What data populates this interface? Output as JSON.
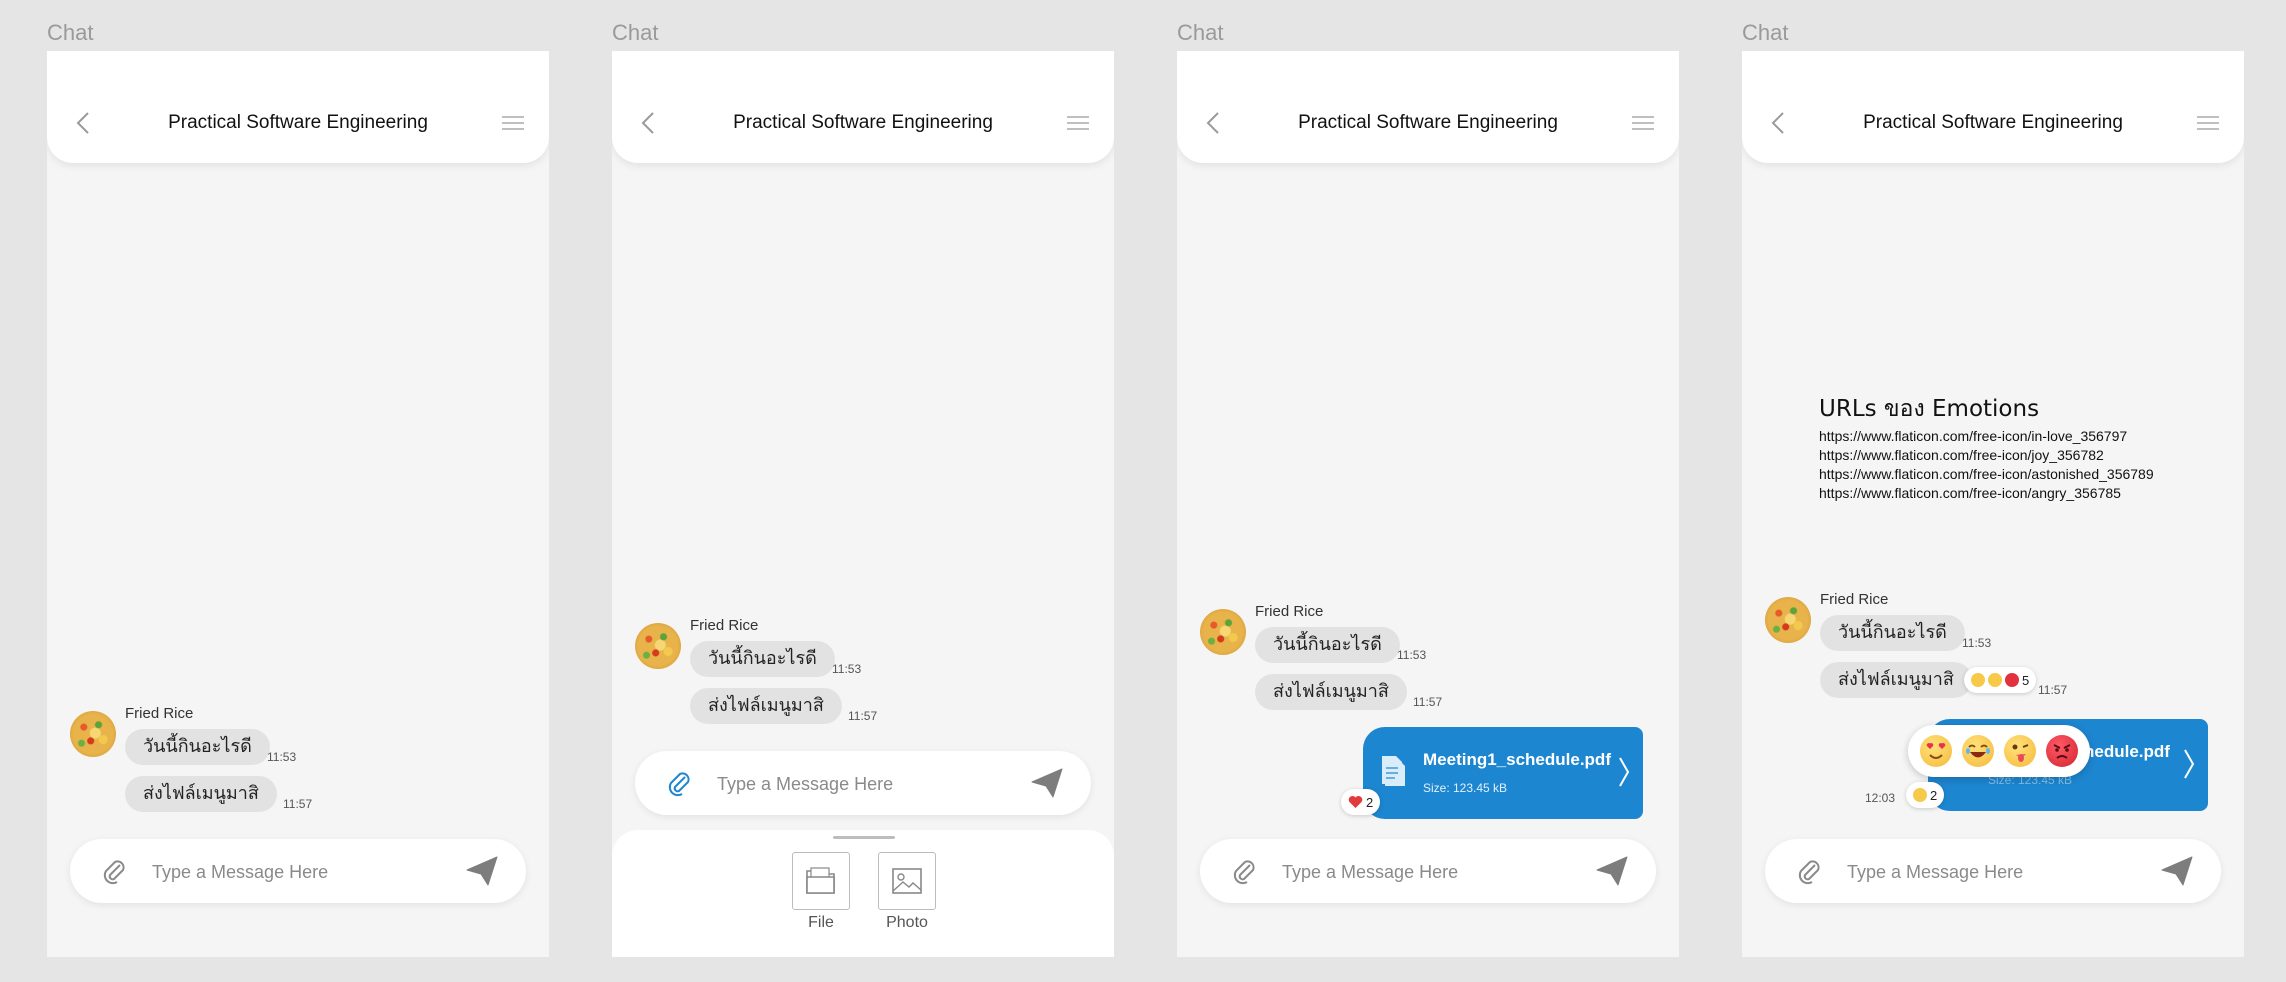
{
  "frames": [
    {
      "label": "Chat"
    },
    {
      "label": "Chat"
    },
    {
      "label": "Chat"
    },
    {
      "label": "Chat"
    }
  ],
  "header": {
    "title": "Practical Software Engineering"
  },
  "sender": {
    "name": "Fried Rice"
  },
  "messages": [
    {
      "text": "วันนี้กินอะไรดี",
      "time": "11:53"
    },
    {
      "text": "ส่งไฟล์เมนูมาสิ",
      "time": "11:57"
    }
  ],
  "input": {
    "placeholder": "Type a Message Here"
  },
  "attach_sheet": {
    "file_label": "File",
    "photo_label": "Photo"
  },
  "file_message": {
    "name": "Meeting1_schedule.pdf",
    "name_partial": "hedule.pdf",
    "size": "Size: 123.45 kB",
    "time": "12:03"
  },
  "reactions": {
    "frame3_count": "2",
    "frame4_text_count": "5",
    "frame4_file_count": "2"
  },
  "emotions": {
    "heading": "URLs ของ Emotions",
    "urls": [
      "https://www.flaticon.com/free-icon/in-love_356797",
      "https://www.flaticon.com/free-icon/joy_356782",
      "https://www.flaticon.com/free-icon/astonished_356789",
      "https://www.flaticon.com/free-icon/angry_356785"
    ]
  },
  "colors": {
    "accent_blue": "#1d86d0",
    "bubble_gray": "#e2e2e2",
    "background": "#e5e5e5",
    "heart_red": "#e23b3b"
  }
}
